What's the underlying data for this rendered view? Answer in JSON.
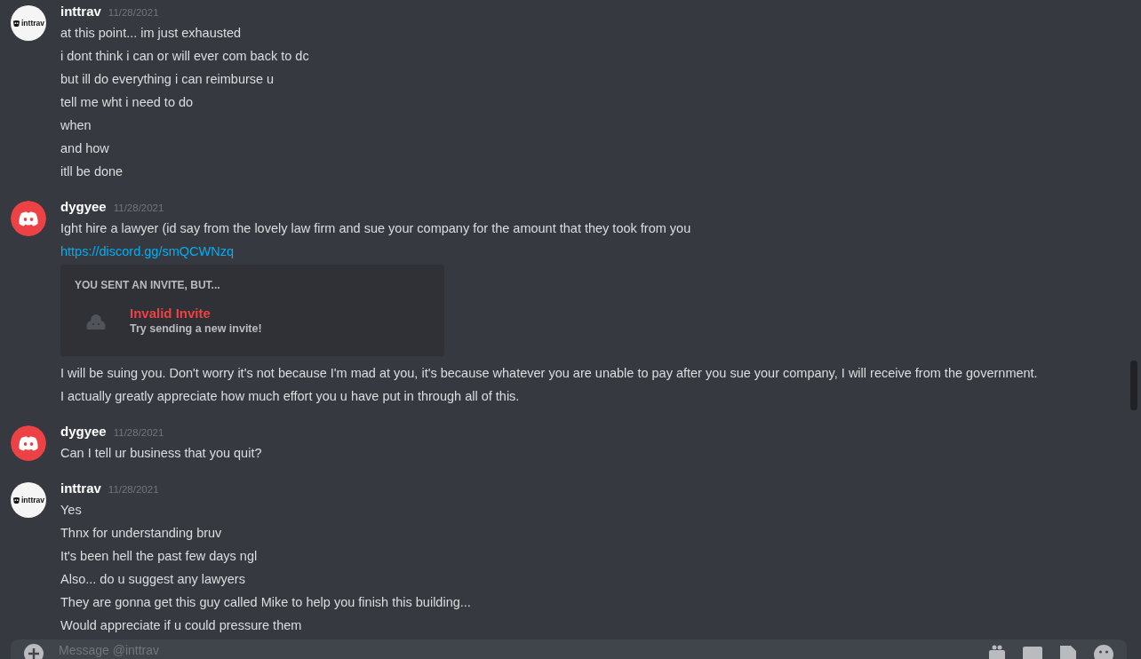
{
  "messages": [
    {
      "author": "inttrav",
      "avatar": {
        "kind": "logo",
        "text": "inttrav"
      },
      "time": "11/28/2021",
      "lines": [
        {
          "kind": "text",
          "text": "at this point... im just exhausted"
        },
        {
          "kind": "text",
          "text": "i dont think i can or will ever com back to dc"
        },
        {
          "kind": "text",
          "text": "but ill do everything i can reimburse u"
        },
        {
          "kind": "text",
          "text": "tell me wht i need to do"
        },
        {
          "kind": "text",
          "text": "when"
        },
        {
          "kind": "text",
          "text": "and how"
        },
        {
          "kind": "text",
          "text": "itll be done"
        }
      ]
    },
    {
      "author": "dygyee",
      "avatar": {
        "kind": "discord"
      },
      "time": "11/28/2021",
      "lines": [
        {
          "kind": "text",
          "text": "Ight hire a lawyer (id say from the lovely law firm and sue your company for the amount that they took from you"
        },
        {
          "kind": "link",
          "text": "https://discord.gg/smQCWNzq"
        },
        {
          "kind": "invite",
          "heading": "YOU SENT AN INVITE, BUT...",
          "title": "Invalid Invite",
          "subtitle": "Try sending a new invite!"
        },
        {
          "kind": "text",
          "text": "I will be suing you. Don't worry it's not because I'm mad at you, it's because whatever you are unable to pay after you sue your company, I will receive from the government."
        },
        {
          "kind": "text",
          "text": "I actually greatly appreciate how much effort you u have put in through all of this."
        }
      ]
    },
    {
      "author": "dygyee",
      "avatar": {
        "kind": "discord"
      },
      "time": "11/28/2021",
      "lines": [
        {
          "kind": "text",
          "text": "Can I tell ur business that you quit?"
        }
      ]
    },
    {
      "author": "inttrav",
      "avatar": {
        "kind": "logo",
        "text": "inttrav"
      },
      "time": "11/28/2021",
      "lines": [
        {
          "kind": "text",
          "text": "Yes"
        },
        {
          "kind": "text",
          "text": "Thnx for understanding bruv"
        },
        {
          "kind": "text",
          "text": "It's been hell the past few days ngl"
        },
        {
          "kind": "text",
          "text": "Also... do u suggest any lawyers"
        },
        {
          "kind": "text",
          "text": "They are gonna get this guy called Mike to help you finish this building..."
        },
        {
          "kind": "text",
          "text": "Would appreciate if u could pressure them"
        }
      ]
    }
  ],
  "composer": {
    "placeholder": "Message @inttrav"
  }
}
